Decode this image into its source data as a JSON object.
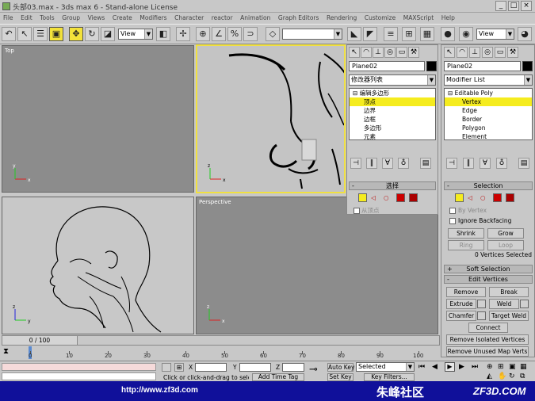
{
  "titlebar": {
    "title": "头部03.max - 3ds max 6 - Stand-alone License",
    "min": "_",
    "max": "□",
    "close": "×"
  },
  "menubar": {
    "items": [
      "File",
      "Edit",
      "Tools",
      "Group",
      "Views",
      "Create",
      "Modifiers",
      "Character",
      "reactor",
      "Animation",
      "Graph Editors",
      "Rendering",
      "Customize",
      "MAXScript",
      "Help"
    ]
  },
  "toolbar": {
    "view1": "View",
    "view2": "View"
  },
  "viewports": {
    "top": "Top",
    "perspective": "Perspective"
  },
  "panel_cn": {
    "name": "Plane02",
    "modifier_list": "修改器列表",
    "stack": [
      "编辑多边形",
      "顶点",
      "边界",
      "边框",
      "多边形",
      "元素"
    ],
    "rollout": "选择",
    "by_vertex": "从顶点"
  },
  "panel_en": {
    "name": "Plane02",
    "modifier_list": "Modifier List",
    "stack": [
      "Editable Poly",
      "Vertex",
      "Edge",
      "Border",
      "Polygon",
      "Element"
    ],
    "selection": "Selection",
    "by_vertex": "By Vertex",
    "ignore_backfacing": "Ignore Backfacing",
    "shrink": "Shrink",
    "grow": "Grow",
    "ring": "Ring",
    "loop": "Loop",
    "status": "0 Vertices Selected",
    "soft_selection": "Soft Selection",
    "edit_vertices": "Edit Vertices",
    "remove": "Remove",
    "break": "Break",
    "extrude": "Extrude",
    "weld": "Weld",
    "chamfer": "Chamfer",
    "target_weld": "Target Weld",
    "connect": "Connect",
    "remove_isolated": "Remove Isolated Vertices",
    "remove_unused": "Remove Unused Map Verts"
  },
  "timeline": {
    "frame": "0 / 100",
    "ticks": [
      "0",
      "10",
      "20",
      "30",
      "40",
      "50",
      "60",
      "70",
      "80",
      "90",
      "100"
    ]
  },
  "status": {
    "x": "X",
    "y": "Y",
    "z": "Z",
    "hint": "Click or click-and-drag to select ob",
    "add_time_tag": "Add Time Tag",
    "auto_key": "Auto Key",
    "selected": "Selected",
    "set_key": "Set Key",
    "key_filters": "Key Filters..."
  },
  "footer": {
    "url": "http://www.zf3d.com",
    "brand_cn": "朱峰社区",
    "brand_en": "ZF3D.COM"
  },
  "colors": {
    "highlight": "#f5ec1f",
    "footer": "#10109a"
  }
}
